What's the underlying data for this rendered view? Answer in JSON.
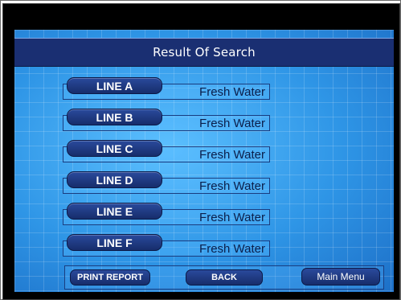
{
  "screen": {
    "title": "Result Of Search"
  },
  "lines": [
    {
      "label": "LINE A",
      "value": "Fresh Water"
    },
    {
      "label": "LINE B",
      "value": "Fresh Water"
    },
    {
      "label": "LINE C",
      "value": "Fresh Water"
    },
    {
      "label": "LINE D",
      "value": "Fresh Water"
    },
    {
      "label": "LINE E",
      "value": "Fresh Water"
    },
    {
      "label": "LINE F",
      "value": "Fresh Water"
    }
  ],
  "buttons": {
    "print_report": "PRINT REPORT",
    "back": "BACK",
    "main_menu": "Main Menu"
  },
  "colors": {
    "title_bar": "#1a2f72",
    "screen_background": "#2f8fe0",
    "tag_fill": "#1e3a85",
    "value_text": "#0b1e4a"
  }
}
